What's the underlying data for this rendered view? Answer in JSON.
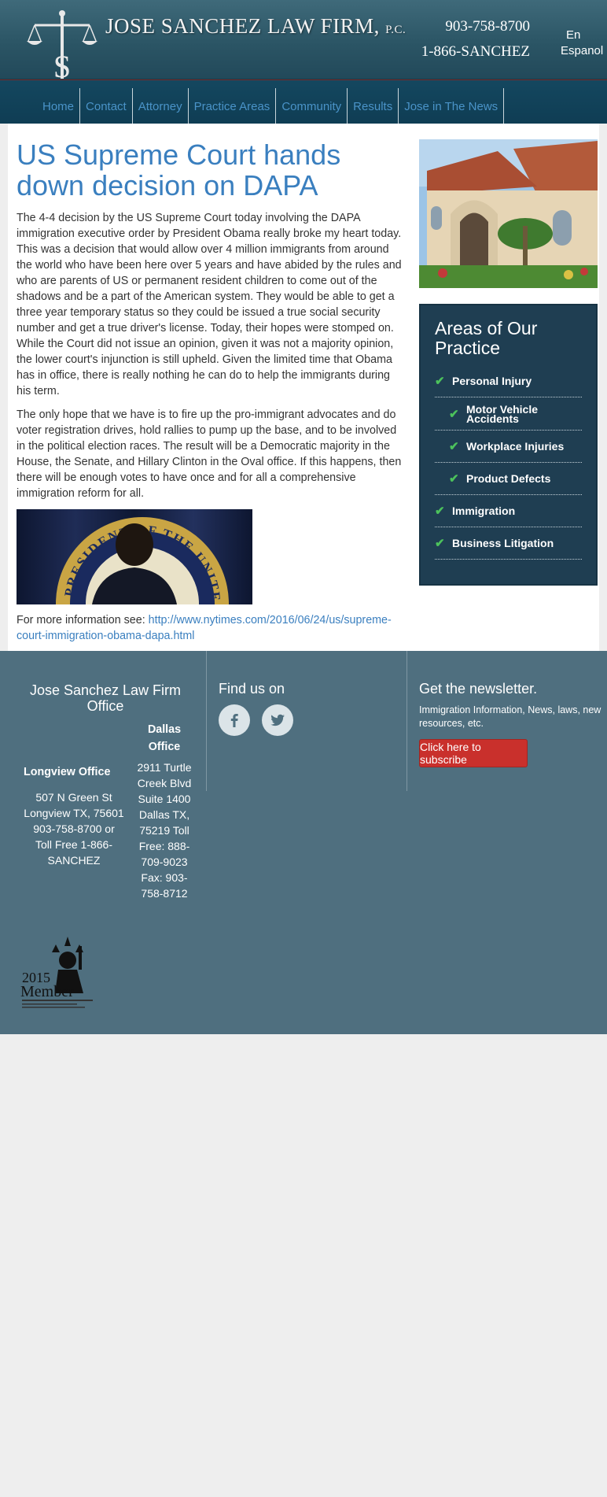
{
  "header": {
    "firm_name": "JOSE SANCHEZ LAW FIRM",
    "firm_suffix": "P.C.",
    "phone_local": "903-758-8700",
    "phone_tollfree": "1-866-SANCHEZ",
    "lang_en": "En",
    "lang_es": "Espanol"
  },
  "nav": {
    "items": [
      "Home",
      "Contact",
      "Attorney",
      "Practice Areas",
      "Community",
      "Results",
      "Jose in The News"
    ]
  },
  "article": {
    "title": "US Supreme Court hands down decision on DAPA",
    "paragraph1": "The 4-4 decision by the US Supreme Court today involving the DAPA immigration executive order by President Obama really broke my heart today. This was a decision that would allow over 4 million immigrants from around the world who have been here over 5 years and have abided by the rules and who are parents of US or permanent resident children to come out of the shadows and be a part of the American system. They would be able to get a three year temporary status so they could be issued a true social security number and get a true driver's license. Today, their hopes were stomped on. While the Court did not issue an opinion, given it was not a majority opinion, the lower court's injunction is still upheld. Given the limited time that Obama has in office, there is really nothing he can do to help the immigrants during his term.",
    "paragraph2": "The only hope that we have is to fire up the pro-immigrant advocates and do voter registration drives, hold rallies to pump up the base, and to be involved in the political election races. The result will be a Democratic majority in the House, the Senate, and Hillary Clinton in the Oval office. If this happens, then there will be enough votes to have once and for all a comprehensive immigration reform for all.",
    "more_info_label": "For more information see: ",
    "more_info_link": "http://www.nytimes.com/2016/06/24/us/supreme-court-immigration-obama-dapa.html",
    "image_seal_text": "PRESIDENT OF THE UNITED"
  },
  "sidebar": {
    "areas_title": "Areas of Our Practice",
    "areas": [
      {
        "label": "Personal Injury",
        "level": 1
      },
      {
        "label": "Motor Vehicle Accidents",
        "level": 2
      },
      {
        "label": "Workplace Injuries",
        "level": 2
      },
      {
        "label": "Product Defects",
        "level": 2
      },
      {
        "label": "Immigration",
        "level": 1
      },
      {
        "label": "Business Litigation",
        "level": 1
      }
    ]
  },
  "footer": {
    "office_title": "Jose Sanchez Law Firm Office",
    "longview": {
      "title": "Longview Office",
      "address": "507 N Green St Longview TX, 75601 903-758-8700 or Toll Free 1-866-SANCHEZ"
    },
    "dallas": {
      "title": "Dallas Office",
      "address": "2911 Turtle Creek Blvd Suite 1400 Dallas TX, 75219 Toll Free: 888-709-9023 Fax: 903-758-8712"
    },
    "find_us_title": "Find us on",
    "newsletter_title": "Get the newsletter.",
    "newsletter_desc": "Immigration Information, News, laws, new resources, etc.",
    "subscribe_label": "Click here to subscribe",
    "badge_year": "2015",
    "badge_word": "Member"
  }
}
